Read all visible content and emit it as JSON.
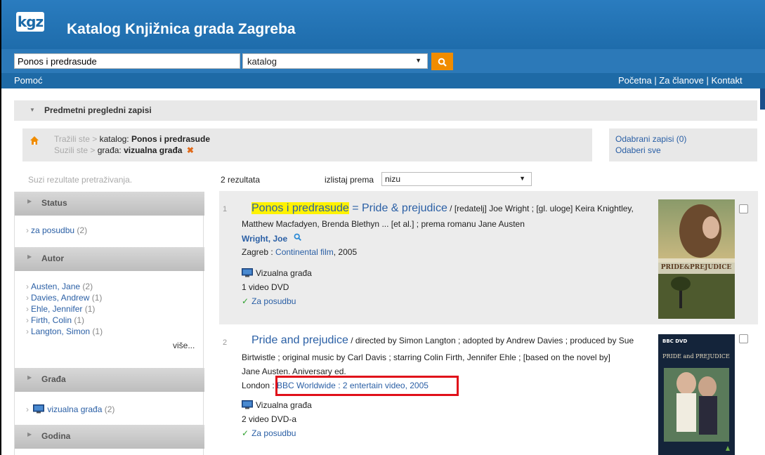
{
  "header": {
    "logo_text": "kgz",
    "title": "Katalog Knjižnica grada Zagreba"
  },
  "search": {
    "value": "Ponos i predrasude",
    "scope": "katalog"
  },
  "nav": {
    "help": "Pomoć",
    "links": "Početna | Za članove | Kontakt"
  },
  "subjects": {
    "label": "Predmetni pregledni zapisi"
  },
  "breadcrumbs": {
    "searched_label": "Tražili ste",
    "searched_field": "katalog:",
    "searched_value": "Ponos i predrasude",
    "narrowed_label": "Suzili ste",
    "narrowed_field": "građa:",
    "narrowed_value": "vizualna građa"
  },
  "selection": {
    "selected_records": "Odabrani zapisi (0)",
    "select_all": "Odaberi sve"
  },
  "sidebar": {
    "heading": "Suzi rezultate pretraživanja.",
    "facets": [
      {
        "title": "Status",
        "items": [
          {
            "label": "za posudbu",
            "count": "(2)"
          }
        ]
      },
      {
        "title": "Autor",
        "items": [
          {
            "label": "Austen, Jane",
            "count": "(2)"
          },
          {
            "label": "Davies, Andrew",
            "count": "(1)"
          },
          {
            "label": "Ehle, Jennifer",
            "count": "(1)"
          },
          {
            "label": "Firth, Colin",
            "count": "(1)"
          },
          {
            "label": "Langton, Simon",
            "count": "(1)"
          }
        ],
        "more": "više..."
      },
      {
        "title": "Građa",
        "items": [
          {
            "label": "vizualna građa",
            "count": "(2)"
          }
        ]
      },
      {
        "title": "Godina",
        "items": []
      }
    ]
  },
  "results": {
    "count": "2 rezultata",
    "sort_label": "izlistaj prema",
    "sort_value": "nizu",
    "items": [
      {
        "number": "1",
        "title_highlight": "Ponos i predrasude",
        "title_rest": " = Pride & prejudice",
        "resp_line1": " / [redatelj] Joe Wright ; [gl. uloge] Keira Knightley,",
        "resp_line2": "Matthew Macfadyen, Brenda Blethyn ... [et al.] ; prema romanu Jane Austen",
        "author": "Wright, Joe",
        "pub_place": "Zagreb : ",
        "publisher": "Continental film",
        "year": ", 2005",
        "material": "Vizualna građa",
        "extent": "1 video DVD",
        "availability": "Za posudbu",
        "cover_text": "PRIDE&PREJUDICE"
      },
      {
        "number": "2",
        "title": "Pride and prejudice",
        "resp_line1": " / directed by Simon Langton ; adopted by Andrew Davies ; produced by Sue",
        "resp_line2": "Birtwistle ; original music by Carl Davis ; starring Colin Firth, Jennifer Ehle ; [based on the novel by]",
        "resp_line3": "Jane Austen. Aniversary ed.",
        "pub_place": "London : ",
        "publisher": "BBC Worldwide : 2 entertain video, 2005",
        "material": "Vizualna građa",
        "extent": "2 video DVD-a",
        "availability": "Za posudbu",
        "cover_text": "PRIDE and PREJUDICE",
        "cover_brand": "BBC DVD"
      }
    ]
  },
  "colors": {
    "header_blue": "#1b6aa8",
    "accent_orange": "#f08c00",
    "link_blue": "#2a5fa5",
    "highlight": "#fff200",
    "annotation_red": "#e0101a"
  }
}
